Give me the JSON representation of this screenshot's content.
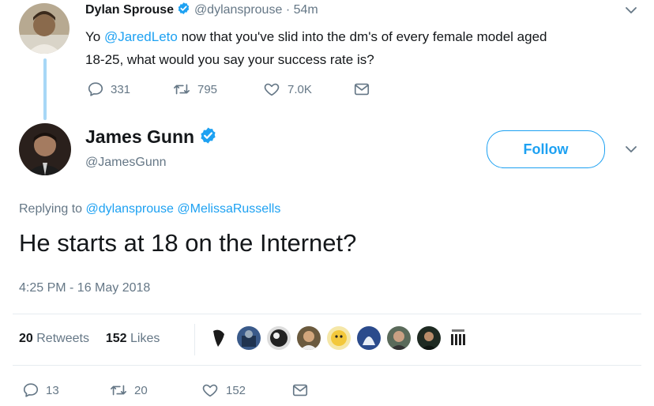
{
  "parent_tweet": {
    "author_name": "Dylan Sprouse",
    "handle": "@dylansprouse",
    "separator": "·",
    "time": "54m",
    "text_prefix": "Yo ",
    "mention": "@JaredLeto",
    "text_line1_rest": " now that you've slid into the dm's of every female model aged",
    "text_line2": "18-25, what would you say your success rate is?",
    "actions": {
      "replies": "331",
      "retweets": "795",
      "likes": "7.0K"
    }
  },
  "main_tweet": {
    "author_name": "James Gunn",
    "handle": "@JamesGunn",
    "follow_label": "Follow",
    "replying_label": "Replying to",
    "replying_to": [
      "@dylansprouse",
      "@MelissaRussells"
    ],
    "text": "He starts at 18 on the Internet?",
    "timestamp": "4:25 PM - 16 May 2018",
    "stats": {
      "retweets_count": "20",
      "retweets_label": "Retweets",
      "likes_count": "152",
      "likes_label": "Likes"
    },
    "actions": {
      "replies": "13",
      "retweets": "20",
      "likes": "152"
    }
  },
  "colors": {
    "accent": "#1da1f2",
    "text": "#14171a",
    "secondary": "#657786",
    "divider": "#e6ecf0"
  },
  "icons": [
    "verified-icon",
    "reply-icon",
    "retweet-icon",
    "like-icon",
    "dm-icon",
    "chevron-down-icon"
  ]
}
